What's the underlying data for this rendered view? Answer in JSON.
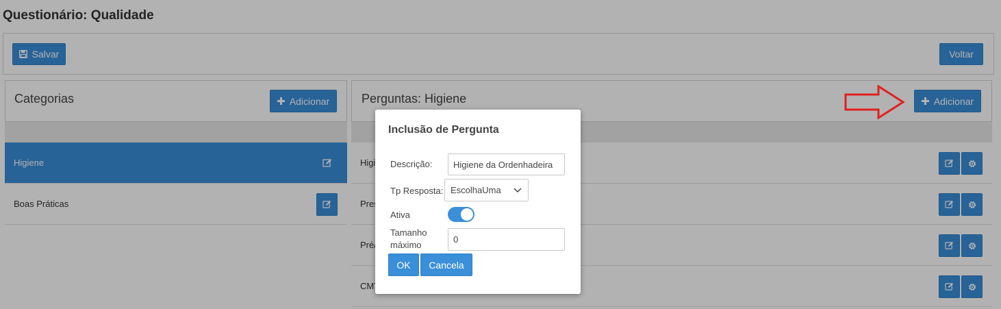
{
  "page": {
    "title": "Questionário: Qualidade"
  },
  "toolbar": {
    "save_label": "Salvar",
    "back_label": "Voltar"
  },
  "categories": {
    "title": "Categorias",
    "add_label": "Adicionar",
    "items": [
      {
        "label": "Higiene",
        "selected": true
      },
      {
        "label": "Boas Práticas",
        "selected": false
      }
    ]
  },
  "questions": {
    "title": "Perguntas: Higiene",
    "add_label": "Adicionar",
    "items": [
      {
        "label": "Higi"
      },
      {
        "label": "Pres"
      },
      {
        "label": "Pré/"
      },
      {
        "label": "CMT"
      }
    ]
  },
  "modal": {
    "title": "Inclusão de Pergunta",
    "descricao_label": "Descrição:",
    "descricao_value": "Higiene da Ordenhadeira",
    "tp_resposta_label": "Tp Resposta:",
    "tp_resposta_value": "EscolhaUma",
    "ativa_label": "Ativa",
    "ativa_on": true,
    "tamanho_label_1": "Tamanho",
    "tamanho_label_2": "máximo",
    "tamanho_value": "0",
    "ok_label": "OK",
    "cancel_label": "Cancela"
  },
  "colors": {
    "primary": "#3a8fd8",
    "annotation_arrow": "#e02020"
  }
}
